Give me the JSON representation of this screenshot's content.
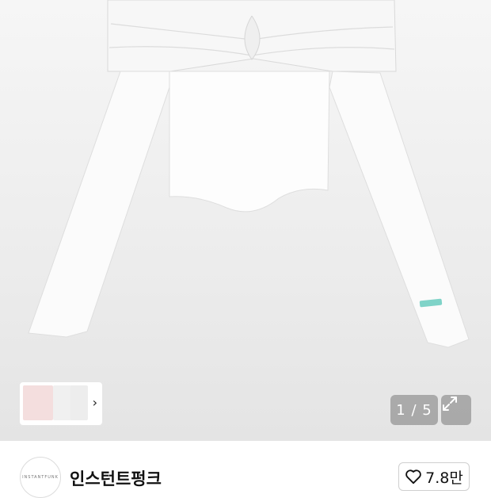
{
  "gallery": {
    "counter": "1 / 5",
    "thumbnail_count_hint": "chevron-right-icon",
    "expand_icon": "expand-icon"
  },
  "shop": {
    "logo_text": "INSTANTFUNK",
    "name": "인스턴트펑크",
    "like_count": "7.8만",
    "like_icon": "heart-icon"
  },
  "colors": {
    "hero_bg": "#ececec",
    "overlay_bg": "rgba(120,120,120,0.55)",
    "label_tag": "#7fd3c8"
  }
}
